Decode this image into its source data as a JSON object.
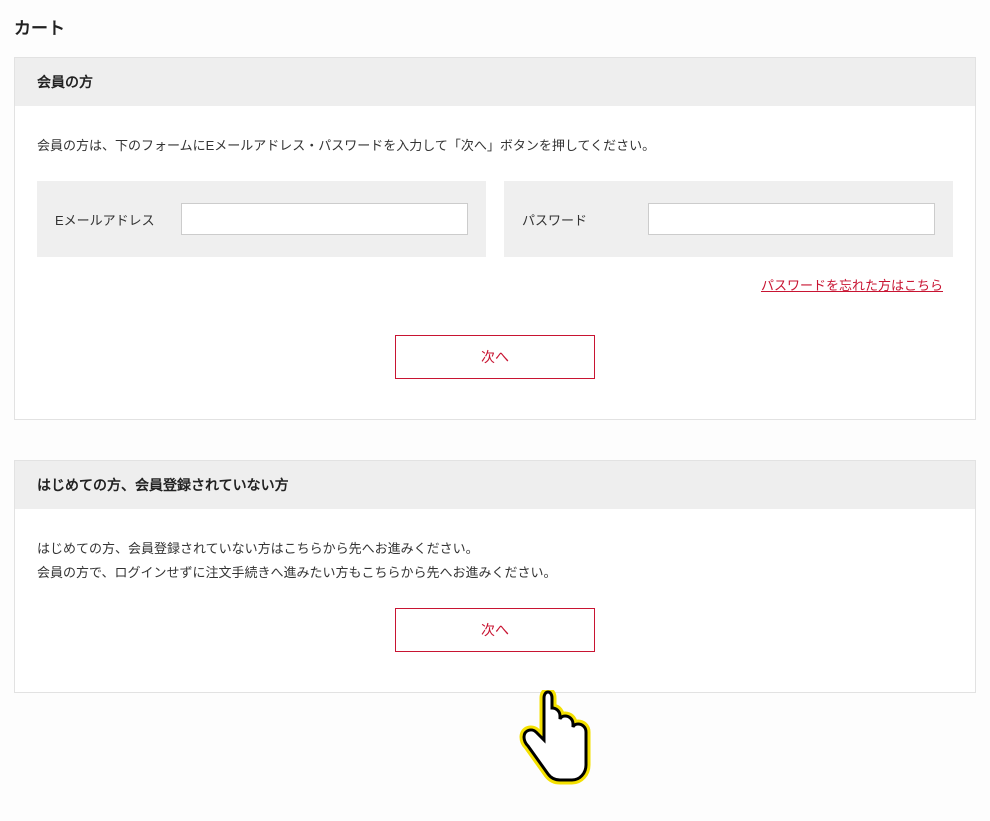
{
  "page_title": "カート",
  "member": {
    "header": "会員の方",
    "instruction": "会員の方は、下のフォームにEメールアドレス・パスワードを入力して「次へ」ボタンを押してください。",
    "email_label": "Eメールアドレス",
    "email_value": "",
    "password_label": "パスワード",
    "password_value": "",
    "forgot_link": "パスワードを忘れた方はこちら",
    "next_label": "次へ"
  },
  "guest": {
    "header": "はじめての方、会員登録されていない方",
    "instruction_line1": "はじめての方、会員登録されていない方はこちらから先へお進みください。",
    "instruction_line2": "会員の方で、ログインせずに注文手続きへ進みたい方もこちらから先へお進みください。",
    "next_label": "次へ"
  }
}
